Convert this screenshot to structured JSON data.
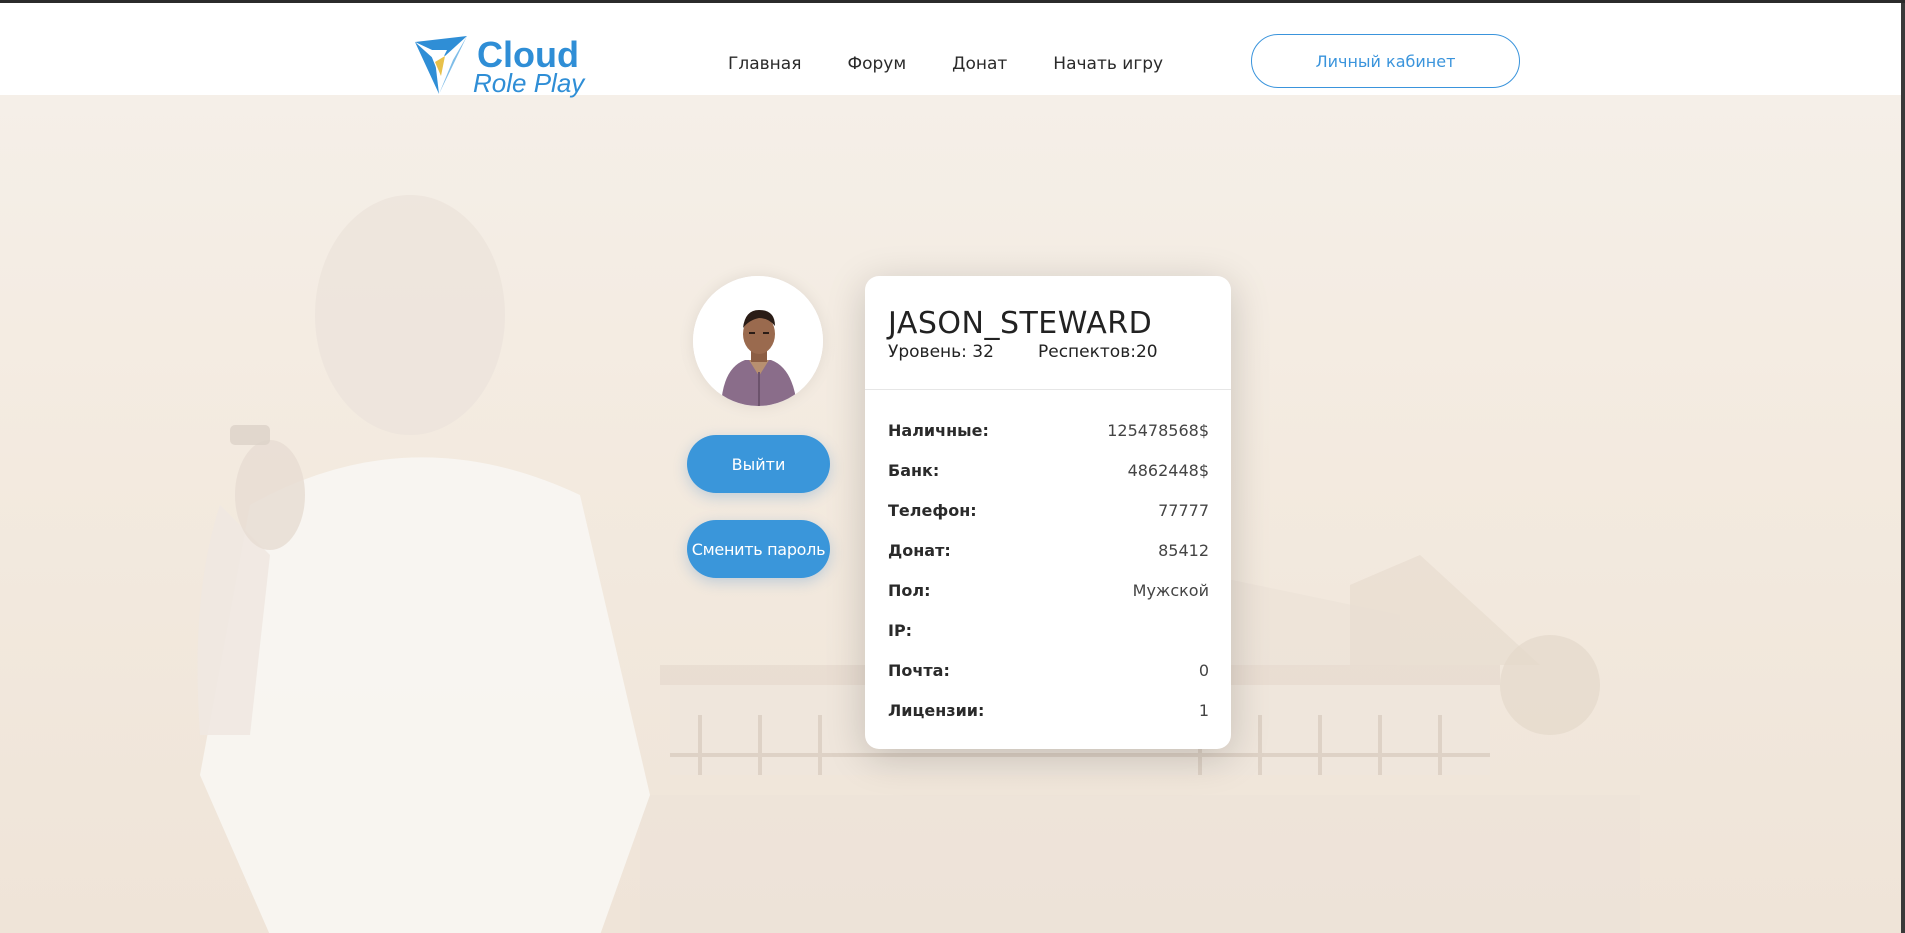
{
  "brand": {
    "line1": "Cloud",
    "line2": "Role Play",
    "color": "#2f8ed6"
  },
  "nav": {
    "items": [
      "Главная",
      "Форум",
      "Донат",
      "Начать игру"
    ]
  },
  "header": {
    "cabinet_label": "Личный кабинет"
  },
  "actions": {
    "logout": "Выйти",
    "change_password": "Сменить пароль"
  },
  "profile": {
    "username": "JASON_STEWARD",
    "level": "Уровень: 32",
    "respect": "Респектов:20",
    "rows": [
      {
        "key": "Наличные:",
        "value": "125478568$"
      },
      {
        "key": "Банк:",
        "value": "4862448$"
      },
      {
        "key": "Телефон:",
        "value": "77777"
      },
      {
        "key": "Донат:",
        "value": "85412"
      },
      {
        "key": "Пол:",
        "value": "Мужской"
      },
      {
        "key": "IP:",
        "value": ""
      },
      {
        "key": "Почта:",
        "value": "0"
      },
      {
        "key": "Лицензии:",
        "value": "1"
      }
    ]
  },
  "colors": {
    "accent": "#3a96da",
    "background": "#f7f1ea"
  }
}
